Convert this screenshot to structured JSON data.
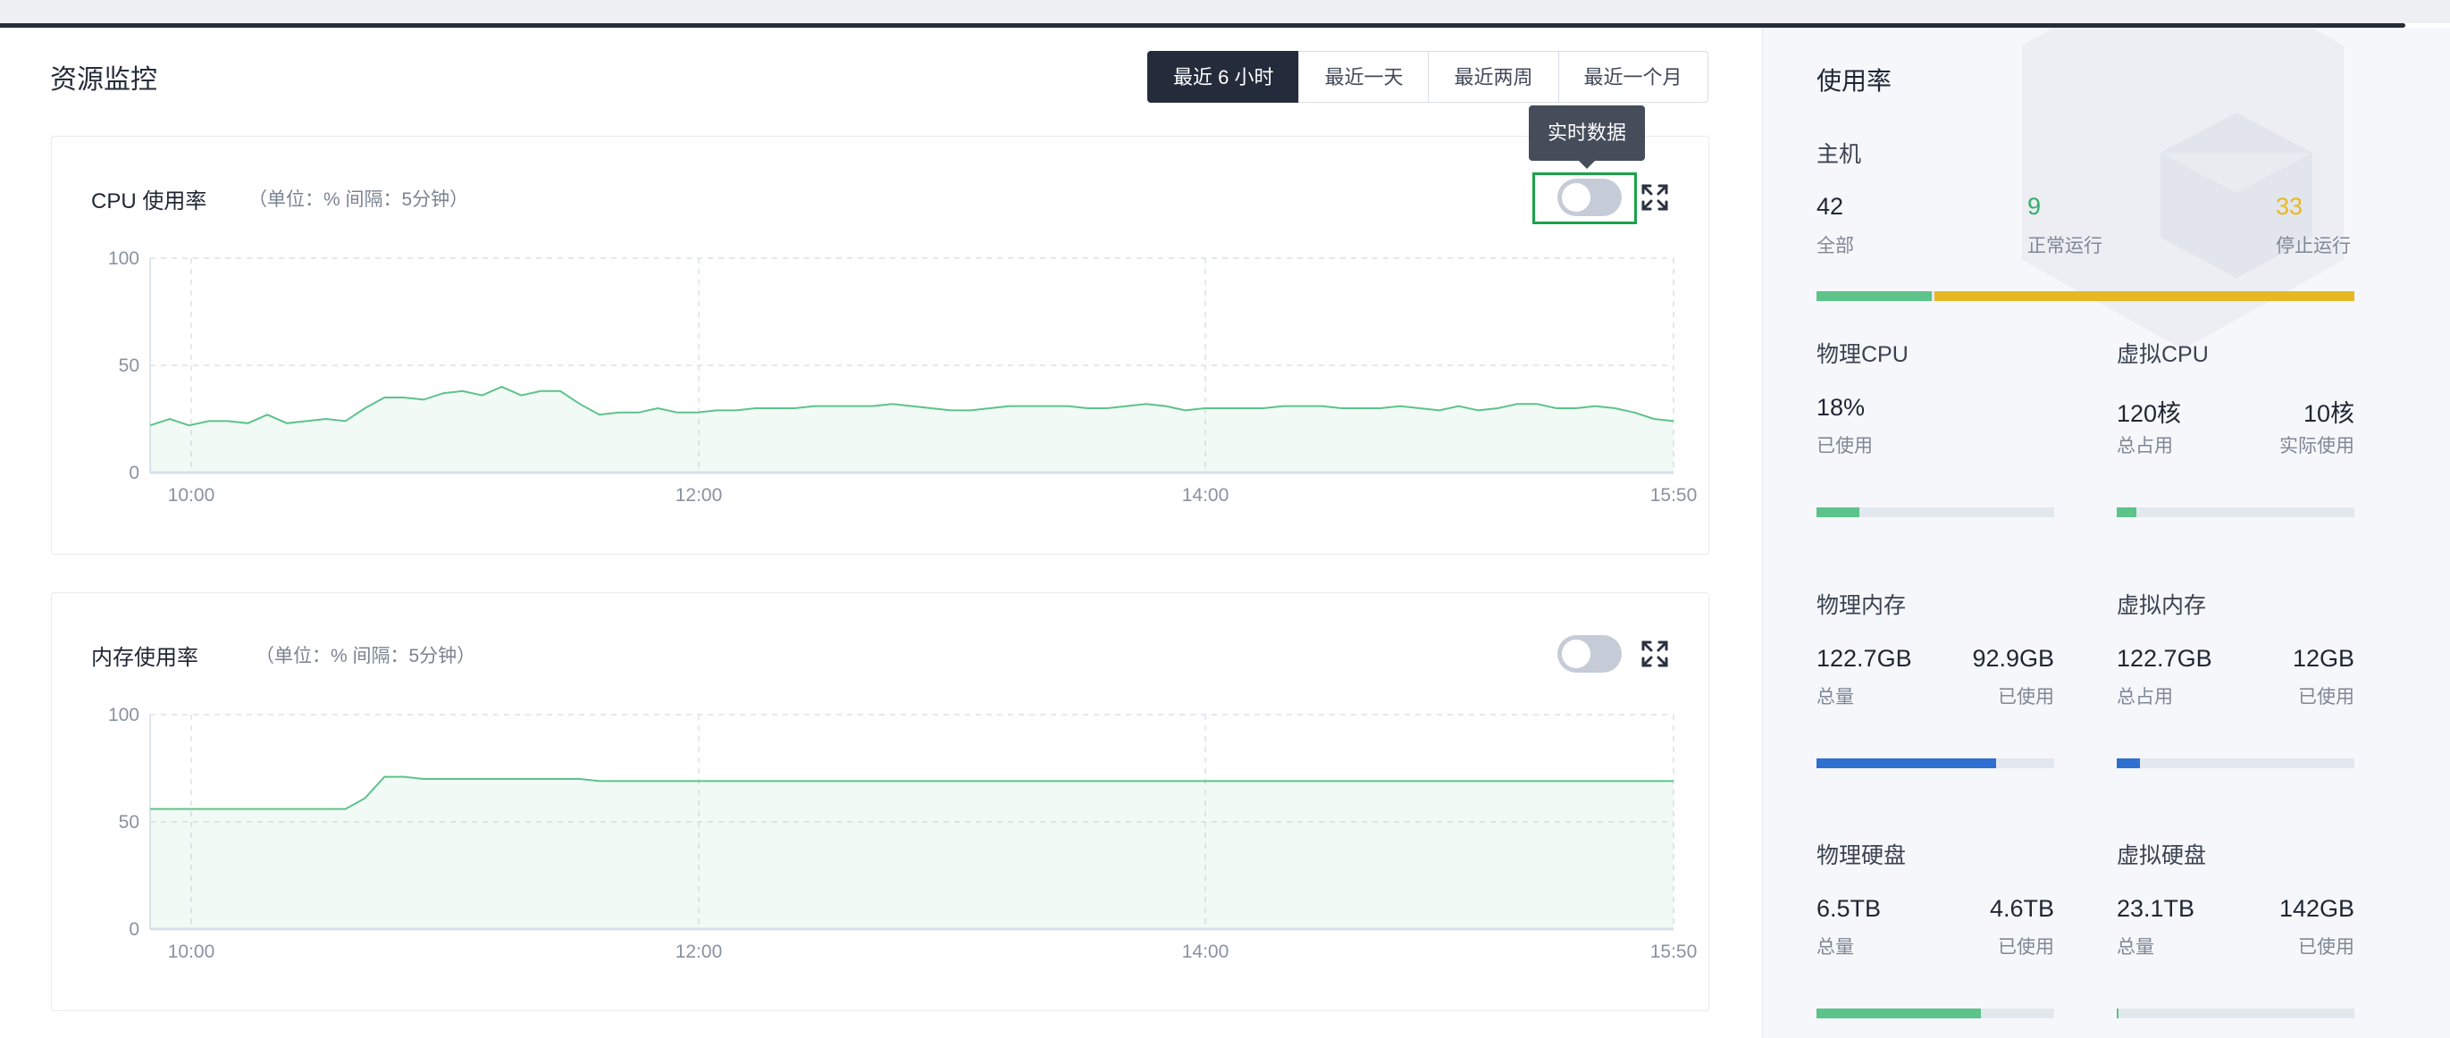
{
  "page": {
    "title": "资源监控"
  },
  "time_range": {
    "options": [
      "最近 6 小时",
      "最近一天",
      "最近两周",
      "最近一个月"
    ],
    "selected_index": 0
  },
  "tooltip": {
    "text": "实时数据"
  },
  "cpu_panel": {
    "title": "CPU 使用率",
    "unit_text": "（单位：%   间隔：5分钟）",
    "realtime_on": false
  },
  "mem_panel": {
    "title": "内存使用率",
    "unit_text": "（单位：%   间隔：5分钟）",
    "realtime_on": false
  },
  "chart_data": [
    {
      "type": "area",
      "title": "CPU 使用率",
      "x_ticks": [
        "10:00",
        "12:00",
        "14:00",
        "15:50"
      ],
      "y_ticks": [
        "100",
        "50",
        "0"
      ],
      "ylim": [
        0,
        100
      ],
      "grid": true,
      "color": "#5cc38a",
      "values": [
        22,
        25,
        22,
        24,
        24,
        23,
        27,
        23,
        24,
        25,
        24,
        30,
        35,
        35,
        34,
        37,
        38,
        36,
        40,
        36,
        38,
        38,
        32,
        27,
        28,
        28,
        30,
        28,
        28,
        29,
        29,
        30,
        30,
        30,
        31,
        31,
        31,
        31,
        32,
        31,
        30,
        29,
        29,
        30,
        31,
        31,
        31,
        31,
        30,
        30,
        31,
        32,
        31,
        29,
        30,
        30,
        30,
        30,
        31,
        31,
        31,
        30,
        30,
        30,
        31,
        30,
        29,
        31,
        29,
        30,
        32,
        32,
        30,
        30,
        31,
        30,
        28,
        25,
        24
      ]
    },
    {
      "type": "area",
      "title": "内存使用率",
      "x_ticks": [
        "10:00",
        "12:00",
        "14:00",
        "15:50"
      ],
      "y_ticks": [
        "100",
        "50",
        "0"
      ],
      "ylim": [
        0,
        100
      ],
      "grid": true,
      "color": "#5cc38a",
      "values": [
        56,
        56,
        56,
        56,
        56,
        56,
        56,
        56,
        56,
        56,
        56,
        61,
        71,
        71,
        70,
        70,
        70,
        70,
        70,
        70,
        70,
        70,
        70,
        69,
        69,
        69,
        69,
        69,
        69,
        69,
        69,
        69,
        69,
        69,
        69,
        69,
        69,
        69,
        69,
        69,
        69,
        69,
        69,
        69,
        69,
        69,
        69,
        69,
        69,
        69,
        69,
        69,
        69,
        69,
        69,
        69,
        69,
        69,
        69,
        69,
        69,
        69,
        69,
        69,
        69,
        69,
        69,
        69,
        69,
        69,
        69,
        69,
        69,
        69,
        69,
        69,
        69,
        69,
        69
      ]
    }
  ],
  "sidebar": {
    "title": "使用率",
    "host": {
      "title": "主机",
      "total": {
        "value": "42",
        "label": "全部"
      },
      "running": {
        "value": "9",
        "label": "正常运行",
        "color": "#36ad6a"
      },
      "stopped": {
        "value": "33",
        "label": "停止运行",
        "color": "#e8b824"
      },
      "running_fraction": 0.214
    },
    "phys_cpu": {
      "title": "物理CPU",
      "used": {
        "value": "18%",
        "label": "已使用"
      },
      "fraction": 0.18,
      "color": "#5cc38a"
    },
    "virt_cpu": {
      "title": "虚拟CPU",
      "total": {
        "value": "120核",
        "label": "总占用"
      },
      "used": {
        "value": "10核",
        "label": "实际使用"
      },
      "fraction": 0.083,
      "color": "#5cc38a"
    },
    "phys_mem": {
      "title": "物理内存",
      "total": {
        "value": "122.7GB",
        "label": "总量"
      },
      "used": {
        "value": "92.9GB",
        "label": "已使用"
      },
      "fraction": 0.757,
      "color": "#2f6fd1"
    },
    "virt_mem": {
      "title": "虚拟内存",
      "total": {
        "value": "122.7GB",
        "label": "总占用"
      },
      "used": {
        "value": "12GB",
        "label": "已使用"
      },
      "fraction": 0.098,
      "color": "#2f6fd1"
    },
    "phys_disk": {
      "title": "物理硬盘",
      "total": {
        "value": "6.5TB",
        "label": "总量"
      },
      "used": {
        "value": "4.6TB",
        "label": "已使用"
      },
      "fraction": 0.69,
      "color": "#5cc38a"
    },
    "virt_disk": {
      "title": "虚拟硬盘",
      "total": {
        "value": "23.1TB",
        "label": "总量"
      },
      "used": {
        "value": "142GB",
        "label": "已使用"
      },
      "fraction": 0.006,
      "color": "#5cc38a"
    }
  }
}
